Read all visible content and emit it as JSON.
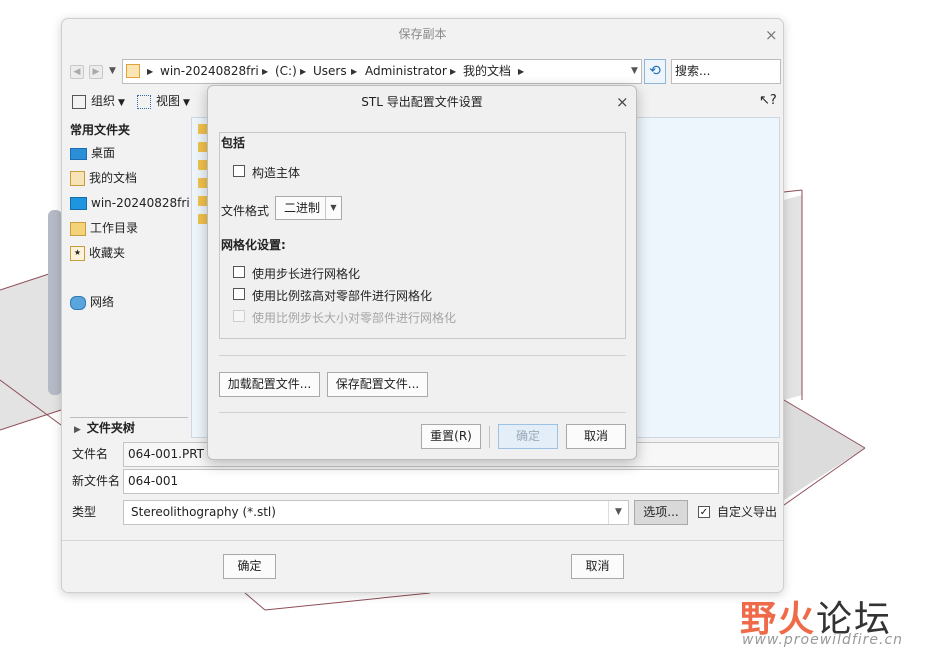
{
  "main_dialog": {
    "title": "保存副本",
    "close": "×",
    "address": [
      "win-20240828fri",
      "(C:)",
      "Users",
      "Administrator",
      "我的文档"
    ],
    "search_placeholder": "搜索...",
    "toolbar": {
      "organize": "组织",
      "view": "视图",
      "help": "?"
    },
    "sidebar": {
      "header": "常用文件夹",
      "items": [
        "桌面",
        "我的文档",
        "win-20240828fri",
        "工作目录",
        "收藏夹",
        "网络"
      ]
    },
    "folder_tree": "文件夹树",
    "file_name_label": "文件名",
    "file_name_value": "064-001.PRT",
    "new_name_label": "新文件名",
    "new_name_value": "064-001",
    "type_label": "类型",
    "type_value": "Stereolithography (*.stl)",
    "options_button": "选项...",
    "custom_export_label": "自定义导出",
    "custom_export_checked": true,
    "ok": "确定",
    "cancel": "取消"
  },
  "stl_dialog": {
    "title": "STL 导出配置文件设置",
    "close": "×",
    "include_heading": "包括",
    "build_body": "构造主体",
    "format_label": "文件格式",
    "format_value": "二进制",
    "mesh_heading": "网格化设置:",
    "mesh_opt1": "使用步长进行网格化",
    "mesh_opt2": "使用比例弦高对零部件进行网格化",
    "mesh_opt3": "使用比例步长大小对零部件进行网格化",
    "load_config": "加载配置文件...",
    "save_config": "保存配置文件...",
    "reset": "重置(R)",
    "ok": "确定",
    "cancel": "取消"
  },
  "watermark": {
    "logo_left": "野火",
    "logo_right": "论坛",
    "url": "www.proewildfire.cn"
  }
}
